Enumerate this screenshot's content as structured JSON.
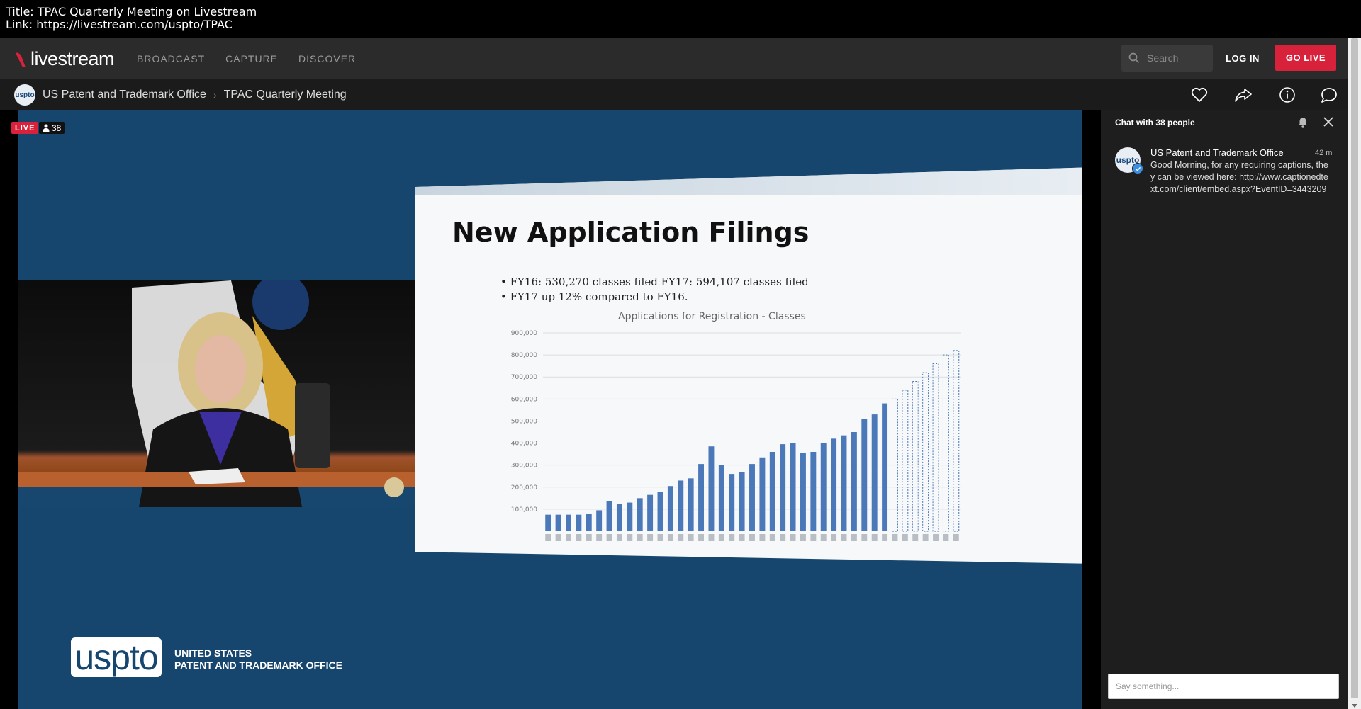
{
  "caption": {
    "title_line": "Title: TPAC Quarterly Meeting on Livestream",
    "link_line": "Link: https://livestream.com/uspto/TPAC"
  },
  "navbar": {
    "logo_text": "livestream",
    "links": [
      "BROADCAST",
      "CAPTURE",
      "DISCOVER"
    ],
    "search_placeholder": "Search",
    "login_label": "LOG IN",
    "golive_label": "GO LIVE",
    "accent_color": "#d8213b"
  },
  "subheader": {
    "avatar_text": "uspto",
    "account_name": "US Patent and Trademark Office",
    "separator": "›",
    "event_name": "TPAC Quarterly Meeting",
    "icons": [
      "heart-icon",
      "share-icon",
      "info-icon",
      "chat-icon"
    ]
  },
  "video": {
    "live_label": "LIVE",
    "viewer_count": "38",
    "slide_title": "New Application Filings",
    "bullet1": "FY16: 530,270 classes filed    FY17:  594,107 classes filed",
    "bullet2": "FY17 up 12% compared to FY16.",
    "chart_title": "Applications for Registration - Classes",
    "uspto_logo": "uspto",
    "uspto_line1": "UNITED STATES",
    "uspto_line2": "PATENT AND TRADEMARK OFFICE"
  },
  "chart_data": {
    "type": "bar",
    "title": "Applications for Registration - Classes",
    "ylim": [
      0,
      900000
    ],
    "y_ticks": [
      "100,000",
      "200,000",
      "300,000",
      "400,000",
      "500,000",
      "600,000",
      "700,000",
      "800,000",
      "900,000"
    ],
    "y_tick_values": [
      100000,
      200000,
      300000,
      400000,
      500000,
      600000,
      700000,
      800000,
      900000
    ],
    "values": [
      75000,
      75000,
      75000,
      75000,
      80000,
      95000,
      135000,
      125000,
      130000,
      150000,
      165000,
      180000,
      205000,
      230000,
      240000,
      305000,
      385000,
      300000,
      260000,
      270000,
      305000,
      335000,
      360000,
      395000,
      400000,
      355000,
      360000,
      400000,
      420000,
      435000,
      450000,
      510000,
      530000,
      580000,
      600000,
      640000,
      680000,
      720000,
      760000,
      800000,
      820000
    ],
    "projected_from_index": 34,
    "bar_color": "#4a78b8"
  },
  "chat": {
    "header": "Chat with 38 people",
    "message": {
      "avatar_text": "uspto",
      "author": "US Patent and Trademark Office",
      "time": "42 m",
      "body": "Good Morning, for any requiring captions, they can be viewed here: http://www.captionedtext.com/client/embed.aspx?EventID=3443209"
    },
    "input_placeholder": "Say something..."
  }
}
